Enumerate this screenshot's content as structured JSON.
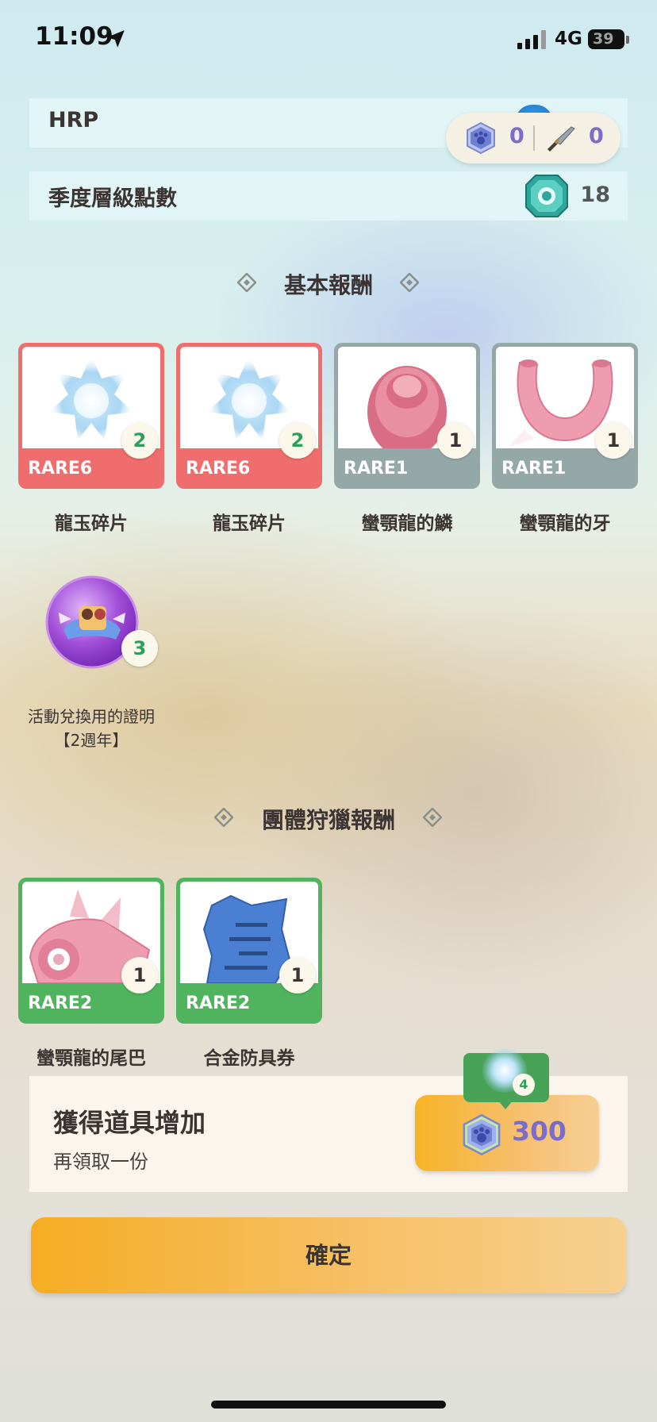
{
  "status_bar": {
    "time": "11:09",
    "network": "4G",
    "battery": "39"
  },
  "hrp": {
    "label": "HRP"
  },
  "currency": {
    "paw_gem_count": "0",
    "knife_count": "0"
  },
  "season_points": {
    "label": "季度層級點數",
    "value": "18"
  },
  "basic_rewards": {
    "title": "基本報酬",
    "items": [
      {
        "rarity": "RARE6",
        "count": "2",
        "name": "龍玉碎片"
      },
      {
        "rarity": "RARE6",
        "count": "2",
        "name": "龍玉碎片"
      },
      {
        "rarity": "RARE1",
        "count": "1",
        "name": "蠻顎龍的鱗"
      },
      {
        "rarity": "RARE1",
        "count": "1",
        "name": "蠻顎龍的牙"
      }
    ],
    "special_item": {
      "count": "3",
      "name_line1": "活動兌換用的證明",
      "name_line2": "【2週年】"
    }
  },
  "group_rewards": {
    "title": "團體狩獵報酬",
    "items": [
      {
        "rarity": "RARE2",
        "count": "1",
        "name": "蠻顎龍的尾巴"
      },
      {
        "rarity": "RARE2",
        "count": "1",
        "name": "合金防具券"
      }
    ]
  },
  "bonus": {
    "title": "獲得道具增加",
    "subtitle": "再領取一份",
    "cost": "300",
    "tooltip_count": "4"
  },
  "confirm_label": "確定",
  "colors": {
    "rare6": "#ef6e6d",
    "rare1": "#95a8a8",
    "rare2": "#50b45f",
    "accent_orange": "#f6ad24",
    "currency_purple": "#7a6cc8"
  }
}
